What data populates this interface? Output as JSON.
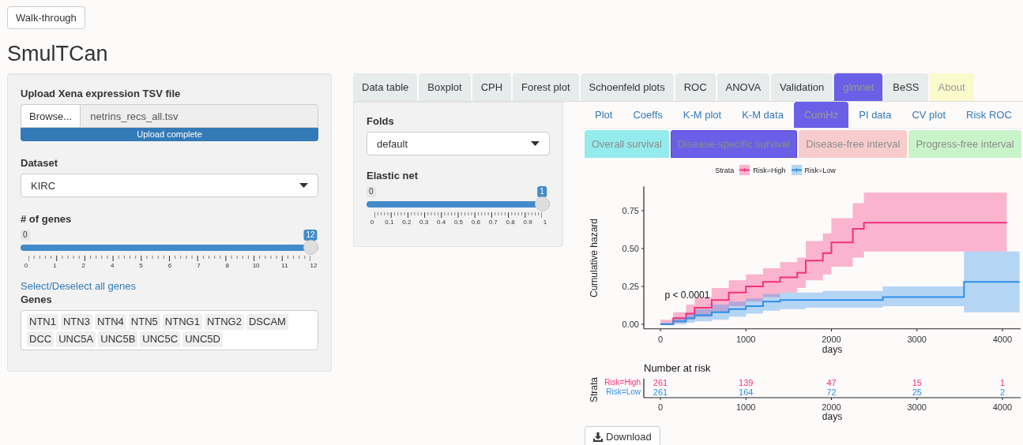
{
  "walkthrough_button": "Walk-through",
  "app_title": "SmulTCan",
  "sidebar": {
    "upload": {
      "label": "Upload Xena expression TSV file",
      "browse": "Browse...",
      "filename": "netrins_recs_all.tsv",
      "progress_text": "Upload complete",
      "level": 1
    },
    "dataset": {
      "label": "Dataset",
      "value": "KIRC"
    },
    "genes_slider": {
      "label": "# of genes",
      "min": "0",
      "max": "12",
      "level": 1,
      "ticks": [
        "0",
        "1",
        "2",
        "4",
        "5",
        "6",
        "7",
        "8",
        "10",
        "11",
        "12"
      ]
    },
    "select_all_link": "Select/Deselect all genes",
    "genes": {
      "label": "Genes",
      "chips": [
        "NTN1",
        "NTN3",
        "NTN4",
        "NTN5",
        "NTNG1",
        "NTNG2",
        "DSCAM",
        "DCC",
        "UNC5A",
        "UNC5B",
        "UNC5C",
        "UNC5D"
      ]
    }
  },
  "tabs": [
    {
      "label": "Data table",
      "selected": false,
      "dimmed": false,
      "color": "#e8ebec"
    },
    {
      "label": "Boxplot",
      "selected": false,
      "dimmed": false,
      "color": "#e8ebec"
    },
    {
      "label": "CPH",
      "selected": false,
      "dimmed": false,
      "color": "#e8ebec"
    },
    {
      "label": "Forest plot",
      "selected": false,
      "dimmed": false,
      "color": "#e8ebec"
    },
    {
      "label": "Schoenfeld plots",
      "selected": false,
      "dimmed": false,
      "color": "#e8ebec"
    },
    {
      "label": "ROC",
      "selected": false,
      "dimmed": false,
      "color": "#e8ebec"
    },
    {
      "label": "ANOVA",
      "selected": false,
      "dimmed": false,
      "color": "#e8ebec"
    },
    {
      "label": "Validation",
      "selected": false,
      "dimmed": false,
      "color": "#e8ebec"
    },
    {
      "label": "glmnet",
      "selected": true,
      "dimmed": true,
      "color": "#6a5fe6"
    },
    {
      "label": "BeSS",
      "selected": false,
      "dimmed": false,
      "color": "#e8ebec"
    },
    {
      "label": "About",
      "selected": false,
      "dimmed": true,
      "color": "#fafacb"
    }
  ],
  "glmnet_panel": {
    "folds": {
      "label": "Folds",
      "value": "default"
    },
    "elastic_net": {
      "label": "Elastic net",
      "min": "0",
      "max": "1",
      "level": 1,
      "ticks": [
        "0",
        "0.1",
        "0.2",
        "0.3",
        "0.4",
        "0.5",
        "0.6",
        "0.7",
        "0.8",
        "0.9",
        "1"
      ]
    }
  },
  "subtabs": [
    {
      "label": "Plot",
      "selected": false
    },
    {
      "label": "Coeffs",
      "selected": false
    },
    {
      "label": "K-M plot",
      "selected": false
    },
    {
      "label": "K-M data",
      "selected": false
    },
    {
      "label": "CumHz",
      "selected": true
    },
    {
      "label": "PI data",
      "selected": false
    },
    {
      "label": "CV plot",
      "selected": false
    },
    {
      "label": "Risk ROC",
      "selected": false
    }
  ],
  "survival_tabs": [
    {
      "label": "Overall survival",
      "selected": false,
      "color": "#94ebeb"
    },
    {
      "label": "Disease-specific survival",
      "selected": true,
      "color": "#6a5fe6"
    },
    {
      "label": "Disease-free interval",
      "selected": false,
      "color": "#f8cccc"
    },
    {
      "label": "Progress-free interval",
      "selected": false,
      "color": "#c9f3c9"
    }
  ],
  "legend_title": "Strata",
  "chart_data": {
    "type": "line",
    "ylabel": "Cumulative hazard",
    "xlabel": "days",
    "xticks": [
      0,
      1000,
      2000,
      3000,
      4000
    ],
    "yticks": [
      {
        "value": 0,
        "label": "0.00"
      },
      {
        "value": 0.25,
        "label": "0.25"
      },
      {
        "value": 0.5,
        "label": "0.50"
      },
      {
        "value": 0.75,
        "label": "0.75"
      }
    ],
    "xlim": [
      -194,
      4213
    ],
    "ylim": [
      -0.03,
      0.91
    ],
    "x": [
      0,
      150,
      150,
      300,
      300,
      400,
      400,
      600,
      600,
      800,
      800,
      1000,
      1000,
      1200,
      1200,
      1400,
      1400,
      1600,
      1600,
      1700,
      1700,
      1900,
      1900,
      2000,
      2000,
      2250,
      2250,
      2380,
      2380,
      2600,
      2600,
      3550,
      3550,
      4050,
      4050,
      4200
    ],
    "series": [
      {
        "name": "Risk=High",
        "color": "#f4317b",
        "values": [
          0,
          0,
          0.04,
          0.04,
          0.07,
          0.07,
          0.11,
          0.11,
          0.16,
          0.16,
          0.21,
          0.21,
          0.25,
          0.25,
          0.28,
          0.28,
          0.31,
          0.31,
          0.34,
          0.34,
          0.42,
          0.42,
          0.47,
          0.47,
          0.54,
          0.54,
          0.63,
          0.63,
          0.67,
          0.67,
          0.67,
          0.67,
          0.67,
          0.67,
          0.67,
          null
        ],
        "lower": [
          0,
          0,
          0.01,
          0.01,
          0.03,
          0.03,
          0.05,
          0.05,
          0.08,
          0.08,
          0.12,
          0.12,
          0.15,
          0.15,
          0.18,
          0.18,
          0.21,
          0.21,
          0.24,
          0.24,
          0.29,
          0.29,
          0.33,
          0.33,
          0.38,
          0.38,
          0.44,
          0.44,
          0.48,
          0.48,
          0.48,
          0.48,
          0.48,
          0.48,
          0.48,
          null
        ],
        "upper": [
          0.03,
          0.03,
          0.08,
          0.08,
          0.13,
          0.13,
          0.18,
          0.18,
          0.24,
          0.24,
          0.29,
          0.29,
          0.33,
          0.33,
          0.37,
          0.37,
          0.41,
          0.41,
          0.44,
          0.44,
          0.55,
          0.55,
          0.6,
          0.6,
          0.7,
          0.7,
          0.8,
          0.8,
          0.87,
          0.87,
          0.87,
          0.87,
          0.87,
          0.87,
          0.87,
          null
        ]
      },
      {
        "name": "Risk=Low",
        "color": "#2f8ee8",
        "values": [
          0,
          0,
          0.02,
          0.02,
          0.04,
          0.04,
          0.06,
          0.06,
          0.08,
          0.08,
          0.1,
          0.1,
          0.12,
          0.12,
          0.15,
          0.15,
          0.16,
          0.16,
          0.16,
          0.16,
          0.16,
          0.16,
          0.16,
          0.16,
          0.16,
          0.16,
          0.16,
          0.16,
          0.16,
          0.16,
          0.18,
          0.18,
          0.28,
          0.28,
          0.28,
          0.28
        ],
        "lower": [
          0,
          0,
          0,
          0,
          0.01,
          0.01,
          0.02,
          0.02,
          0.03,
          0.03,
          0.05,
          0.05,
          0.07,
          0.07,
          0.09,
          0.09,
          0.1,
          0.1,
          0.1,
          0.1,
          0.11,
          0.11,
          0.11,
          0.11,
          0.11,
          0.11,
          0.11,
          0.11,
          0.11,
          0.11,
          0.12,
          0.12,
          0.08,
          0.08,
          0.08,
          0.08
        ],
        "upper": [
          0.01,
          0.01,
          0.04,
          0.04,
          0.07,
          0.07,
          0.1,
          0.1,
          0.13,
          0.13,
          0.15,
          0.15,
          0.17,
          0.17,
          0.2,
          0.2,
          0.21,
          0.21,
          0.21,
          0.21,
          0.21,
          0.21,
          0.22,
          0.22,
          0.22,
          0.22,
          0.22,
          0.22,
          0.22,
          0.22,
          0.25,
          0.25,
          0.48,
          0.48,
          0.48,
          0.48
        ]
      }
    ],
    "annotations": [
      "p < 0.0001"
    ]
  },
  "risk_table": {
    "title": "Number at risk",
    "ylabel": "Strata",
    "xlabel": "days",
    "xticks": [
      "0",
      "1000",
      "2000",
      "3000",
      "4000"
    ],
    "rows": [
      {
        "name": "Risk=High",
        "color": "#f4317b",
        "counts": [
          "261",
          "139",
          "47",
          "15",
          "1"
        ]
      },
      {
        "name": "Risk=Low",
        "color": "#2f8ee8",
        "counts": [
          "261",
          "164",
          "72",
          "25",
          "2"
        ]
      }
    ]
  },
  "download_button": "Download"
}
